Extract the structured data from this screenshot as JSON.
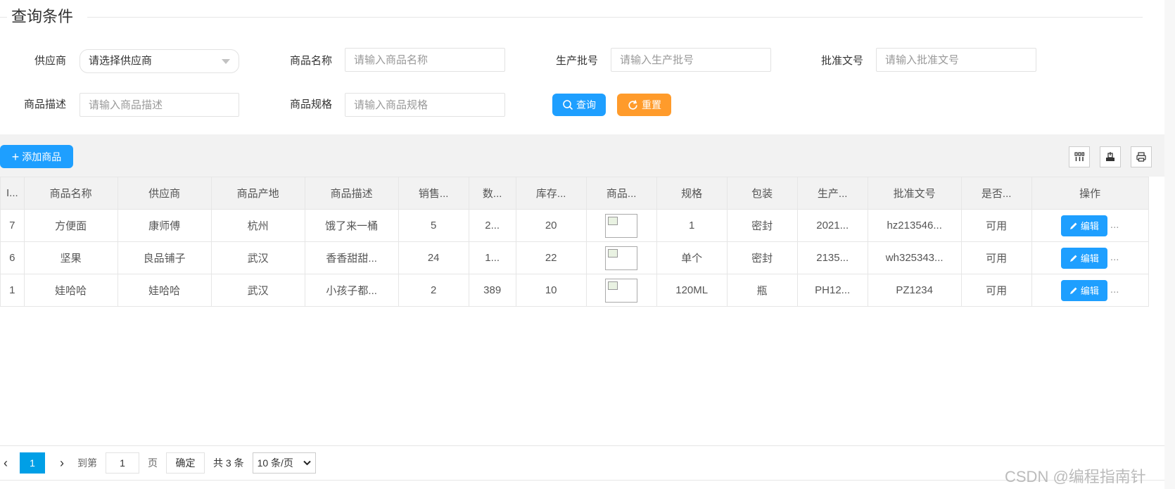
{
  "query": {
    "title": "查询条件",
    "fields": {
      "supplier_label": "供应商",
      "supplier_value": "请选择供应商",
      "name_label": "商品名称",
      "name_placeholder": "请输入商品名称",
      "batch_label": "生产批号",
      "batch_placeholder": "请输入生产批号",
      "approval_label": "批准文号",
      "approval_placeholder": "请输入批准文号",
      "desc_label": "商品描述",
      "desc_placeholder": "请输入商品描述",
      "spec_label": "商品规格",
      "spec_placeholder": "请输入商品规格"
    },
    "search_button": "查询",
    "reset_button": "重置"
  },
  "toolbar": {
    "add_button": "添加商品"
  },
  "table": {
    "headers": [
      "I...",
      "商品名称",
      "供应商",
      "商品产地",
      "商品描述",
      "销售...",
      "数...",
      "库存...",
      "商品...",
      "规格",
      "包装",
      "生产...",
      "批准文号",
      "是否...",
      "操作"
    ],
    "rows": [
      {
        "id": "7",
        "name": "方便面",
        "supplier": "康师傅",
        "origin": "杭州",
        "desc": "饿了来一桶",
        "sales": "5",
        "qty": "2...",
        "stock": "20",
        "spec": "1",
        "pack": "密封",
        "batch": "2021...",
        "approval": "hz213546...",
        "status": "可用"
      },
      {
        "id": "6",
        "name": "坚果",
        "supplier": "良品铺子",
        "origin": "武汉",
        "desc": "香香甜甜...",
        "sales": "24",
        "qty": "1...",
        "stock": "22",
        "spec": "单个",
        "pack": "密封",
        "batch": "2135...",
        "approval": "wh325343...",
        "status": "可用"
      },
      {
        "id": "1",
        "name": "娃哈哈",
        "supplier": "娃哈哈",
        "origin": "武汉",
        "desc": "小孩子都...",
        "sales": "2",
        "qty": "389",
        "stock": "10",
        "spec": "120ML",
        "pack": "瓶",
        "batch": "PH12...",
        "approval": "PZ1234",
        "status": "可用"
      }
    ],
    "edit_label": "编辑",
    "more_label": "..."
  },
  "pagination": {
    "current_page": "1",
    "goto_label": "到第",
    "goto_value": "1",
    "page_unit": "页",
    "confirm": "确定",
    "total": "共 3 条",
    "page_size": "10 条/页"
  },
  "watermark": "CSDN @编程指南针"
}
